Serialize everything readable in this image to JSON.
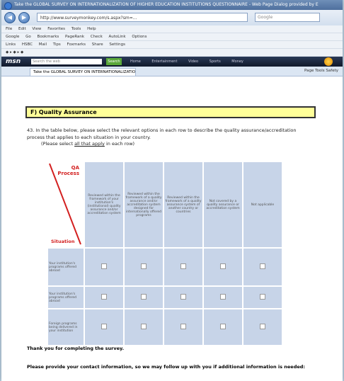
{
  "browser": {
    "title": "Take the GLOBAL SURVEY ON INTERNATIONALIZATION OF HIGHER EDUCATION INSTITUTIONS QUESTIONNAIRE - Web Page Dialog provided by E",
    "url": "http://www.surveymonkey.com/s.aspx?sm=...",
    "search_placeholder": "Google",
    "toolbar_items": [
      "File",
      "Edit",
      "View",
      "Favorites",
      "Tools",
      "Help",
      "Google",
      "Go",
      "Bookmarks",
      "PageRank",
      "Check",
      "AutoLink",
      "Options",
      "Links",
      "HSBC",
      "Mail",
      "Tips",
      "Foxmarks",
      "Share",
      "Settings"
    ],
    "msn_brand": "msn",
    "msn_search_placeholder": "Search the web",
    "msn_go": "Search",
    "msn_links": [
      "Home",
      "Entertainment",
      "Video",
      "Sports",
      "Money"
    ],
    "tab_title": "Take the GLOBAL SURVEY ON INTERNATIONALIZATION...",
    "tab_tools": "Page  Tools  Safety"
  },
  "survey": {
    "section_title": "F) Quality Assurance",
    "question": "43. In the table below, please select the relevant options in each row to describe the quality assurance/accreditation process that applies to each situation in your country.",
    "instruction_prefix": "(Please select ",
    "instruction_emph": "all that apply",
    "instruction_suffix": " in each row)",
    "corner_qa": "QA Process",
    "corner_situation": "Situation",
    "columns": [
      "Reviewed within the framework of your institution's (institutional) quality assurance and/or accreditation system",
      "Reviewed within the framework of a quality assurance and/or accreditation system designed for internationally offered programs",
      "Reviewed within the framework of a quality assurance system of another country or countries",
      "Not covered by a quality assurance or accreditation system",
      "Not applicable"
    ],
    "rows": [
      "Your institution's programs offered abroad",
      "Your institution's programs offered abroad",
      "Foreign programs being delivered in your institution"
    ],
    "thanks": "Thank you for completing the survey.",
    "contact": "Please provide your contact information, so we may follow up with you if additional information is needed:"
  }
}
